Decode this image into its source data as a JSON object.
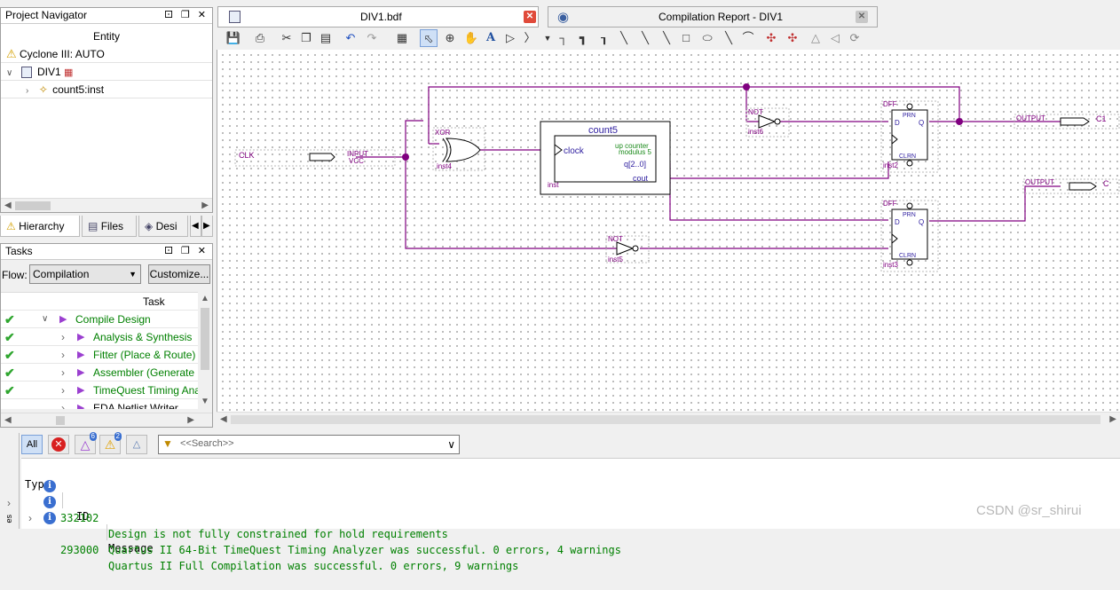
{
  "project_navigator": {
    "title": "Project Navigator",
    "header_buttons": "⚀ ❐ ✕",
    "column": "Entity",
    "device": "Cyclone III: AUTO",
    "top_entity": "DIV1",
    "child": "count5:inst"
  },
  "left_tabs": {
    "hierarchy": "Hierarchy",
    "files": "Files",
    "design": "Desi"
  },
  "tasks": {
    "title": "Tasks",
    "flow_label": "Flow:",
    "flow_value": "Compilation",
    "customize_button": "Customize...",
    "column": "Task",
    "items": [
      {
        "label": "Compile Design"
      },
      {
        "label": "Analysis & Synthesis"
      },
      {
        "label": "Fitter (Place & Route)"
      },
      {
        "label": "Assembler (Generate pro"
      },
      {
        "label": "TimeQuest Timing Analys"
      },
      {
        "label": "EDA Netlist Writer"
      }
    ]
  },
  "editor_tabs": [
    {
      "label": "DIV1.bdf"
    },
    {
      "label": "Compilation Report - DIV1"
    }
  ],
  "schematic": {
    "clk_pin": "CLK",
    "input_type": "INPUT",
    "vcc": "VCC",
    "xor_label": "XOR",
    "xor_inst": "inst4",
    "counter_title": "count5",
    "counter_clock": "clock",
    "counter_desc1": "up counter",
    "counter_desc2": "modulus 5",
    "counter_q": "q[2..0]",
    "counter_cout": "cout",
    "counter_inst": "inst",
    "not1_label": "NOT",
    "not1_inst": "inst6",
    "not2_label": "NOT",
    "not2_inst": "inst5",
    "dff_label": "DFF",
    "prn": "PRN",
    "clrn": "CLRN",
    "d": "D",
    "q": "Q",
    "dff1_inst": "inst2",
    "dff2_inst": "inst3",
    "out_type": "OUTPUT",
    "out1_name": "C1",
    "out2_name": "C"
  },
  "messages_toolbar": {
    "all": "All",
    "warn_badge": "6",
    "crit_badge": "2",
    "search_placeholder": "<<Search>>"
  },
  "messages": {
    "headers": {
      "type": "Type",
      "id": "ID",
      "message": "Message"
    },
    "rows": [
      {
        "id": "332102",
        "text": "Design is not fully constrained for hold requirements"
      },
      {
        "id": "",
        "text": "Quartus II 64-Bit TimeQuest Timing Analyzer was successful. 0 errors, 4 warnings"
      },
      {
        "id": "293000",
        "text": "Quartus II Full Compilation was successful. 0 errors, 9 warnings"
      }
    ]
  },
  "side_label": "es",
  "watermark": "CSDN @sr_shirui",
  "colors": {
    "wire": "#800080",
    "label": "#800080",
    "ok": "#2fa62f",
    "msg": "#008000"
  }
}
